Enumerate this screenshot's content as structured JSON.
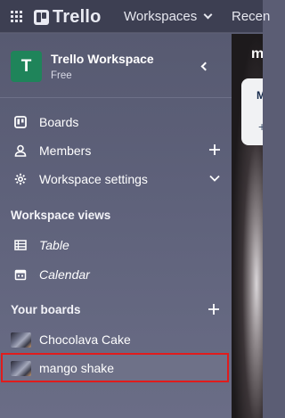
{
  "topbar": {
    "logo_text": "Trello",
    "nav": [
      {
        "label": "Workspaces"
      },
      {
        "label": "Recen"
      }
    ]
  },
  "workspace": {
    "avatar_letter": "T",
    "name": "Trello Workspace",
    "plan": "Free"
  },
  "sidebar": {
    "items": [
      {
        "label": "Boards",
        "icon": "board-icon"
      },
      {
        "label": "Members",
        "icon": "person-icon",
        "action": "plus-icon"
      },
      {
        "label": "Workspace settings",
        "icon": "gear-icon",
        "action": "chevron-down-icon"
      }
    ],
    "views_title": "Workspace views",
    "views": [
      {
        "label": "Table",
        "icon": "table-icon"
      },
      {
        "label": "Calendar",
        "icon": "calendar-icon"
      }
    ],
    "boards_title": "Your boards",
    "boards": [
      {
        "label": "Chocolava Cake"
      },
      {
        "label": "mango shake",
        "selected": true
      }
    ]
  },
  "board": {
    "title_fragment": "m",
    "list_title_fragment": "M",
    "add_fragment": "+"
  },
  "colors": {
    "topbar_bg": "#3d3f52",
    "sidebar_bg": "#5e617a",
    "workspace_avatar": "#1f845a",
    "selection_outline": "#e01c1c"
  }
}
